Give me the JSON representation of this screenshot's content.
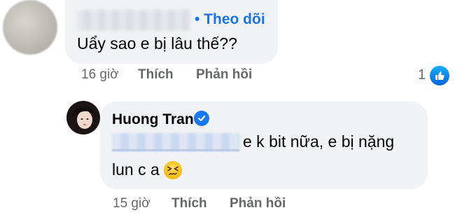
{
  "comment1": {
    "follow_label": "• Theo dõi",
    "text": "Uẩy sao e bị lâu thế??",
    "time": "16 giờ",
    "like_label": "Thích",
    "reply_label": "Phản hồi",
    "reaction_count": "1",
    "reaction_icon": "like-icon"
  },
  "reply1": {
    "author": "Huong Tran",
    "verified_icon": "verified-badge-icon",
    "text_line1": "e k bit nữa, e bị nặng",
    "text_line2": "lun c a",
    "emoji_icon": "persevering-face-emoji",
    "time": "15 giờ",
    "like_label": "Thích",
    "reply_label": "Phản hồi"
  },
  "colors": {
    "bubble": "#f0f2f5",
    "link_blue": "#1b74e4",
    "meta_gray": "#65676b",
    "verified_blue": "#1877f2"
  }
}
